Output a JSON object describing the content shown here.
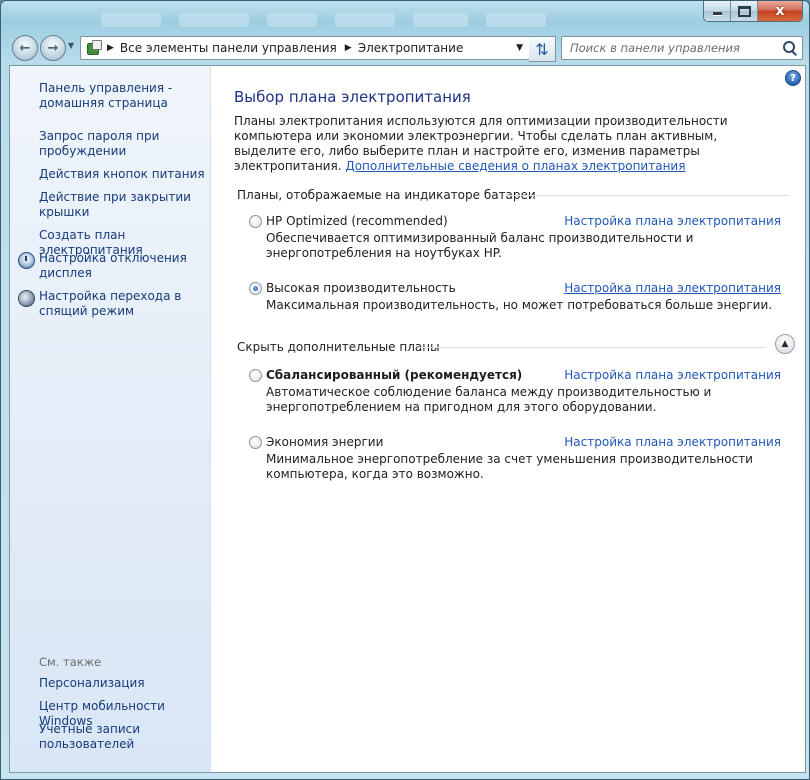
{
  "window": {
    "caption_min": "",
    "caption_max": "",
    "caption_close": "x"
  },
  "navbar": {
    "breadcrumbs": [
      "Все элементы панели управления",
      "Электропитание"
    ],
    "search_placeholder": "Поиск в панели управления"
  },
  "sidebar": {
    "home": "Панель управления - домашняя страница",
    "items": [
      {
        "label": "Запрос пароля при пробуждении"
      },
      {
        "label": "Действия кнопок питания"
      },
      {
        "label": "Действие при закрытии крышки"
      },
      {
        "label": "Создать план электропитания"
      },
      {
        "label": "Настройка отключения дисплея",
        "icon": "display-clock-icon"
      },
      {
        "label": "Настройка перехода в спящий режим",
        "icon": "sleep-moon-icon"
      }
    ],
    "see_also_title": "См. также",
    "see_also": [
      {
        "label": "Персонализация"
      },
      {
        "label": "Центр мобильности Windows"
      },
      {
        "label": "Учетные записи пользователей"
      }
    ]
  },
  "main": {
    "help": "?",
    "title": "Выбор плана электропитания",
    "intro_text": "Планы электропитания используются для оптимизации производительности компьютера или экономии электроэнергии. Чтобы сделать план активным, выделите его, либо выберите план и настройте его, изменив параметры электропитания.",
    "intro_link": "Дополнительные сведения о планах электропитания",
    "section_battery": "Планы, отображаемые на индикаторе батареи",
    "section_hidden": "Скрыть дополнительные планы",
    "plan_link_label": "Настройка плана электропитания",
    "plans": [
      {
        "name": "HP Optimized (recommended)",
        "desc": "Обеспечивается оптимизированный баланс производительности и энергопотребления на ноутбуках HP.",
        "selected": false
      },
      {
        "name": "Высокая производительность",
        "desc": "Максимальная производительность, но может потребоваться больше энергии.",
        "selected": true
      },
      {
        "name": "Сбалансированный (рекомендуется)",
        "desc": "Автоматическое соблюдение баланса между производительностью и энергопотреблением на пригодном для этого оборудовании.",
        "selected": false
      },
      {
        "name": "Экономия энергии",
        "desc": "Минимальное энергопотребление за счет уменьшения производительности компьютера, когда это возможно.",
        "selected": false
      }
    ]
  },
  "colors": {
    "link": "#2157b8",
    "title": "#1e3287",
    "sidebar_bg": "#e4edf8"
  }
}
